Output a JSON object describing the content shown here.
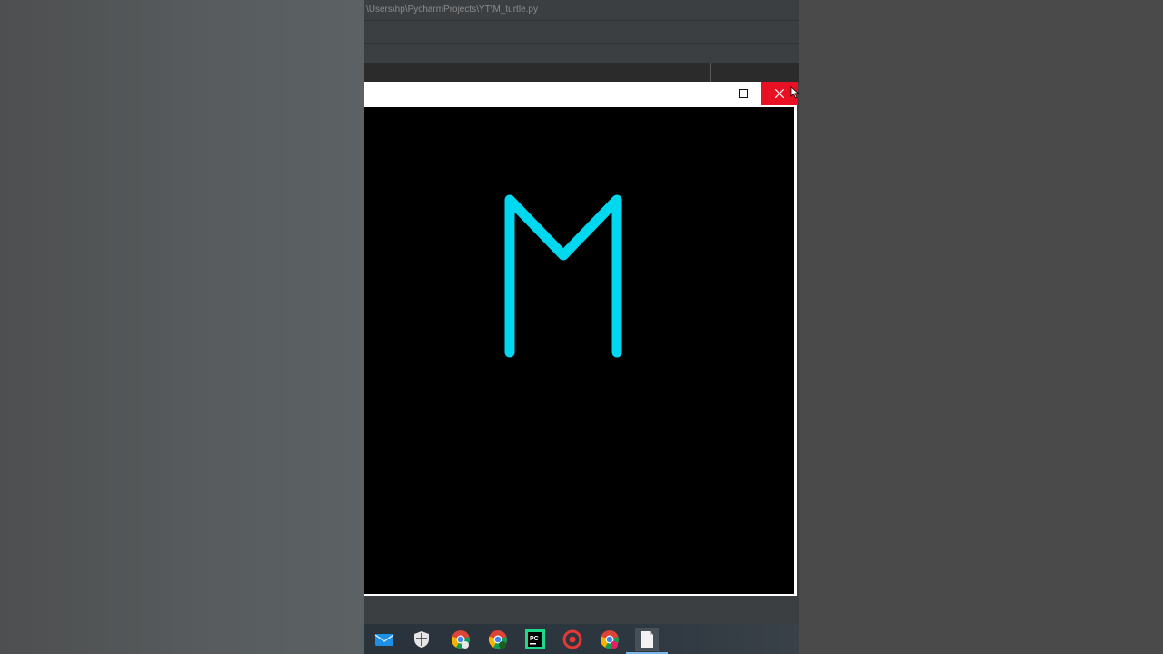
{
  "ide": {
    "path": "\\Users\\hp\\PycharmProjects\\YT\\M_turtle.py"
  },
  "turtle_window": {
    "buttons": [
      "minimize-icon",
      "maximize-icon",
      "close-icon"
    ],
    "close_color": "#e81123",
    "canvas_background": "#000000",
    "drawing": {
      "letter": "M",
      "pen_color": "#00d8f0"
    }
  },
  "taskbar": {
    "icons": [
      "mail-icon",
      "shield-icon",
      "chrome-icon",
      "chrome-canary-icon",
      "pycharm-icon",
      "record-icon",
      "chrome-profile-icon",
      "file-icon"
    ],
    "active": "file-icon"
  }
}
